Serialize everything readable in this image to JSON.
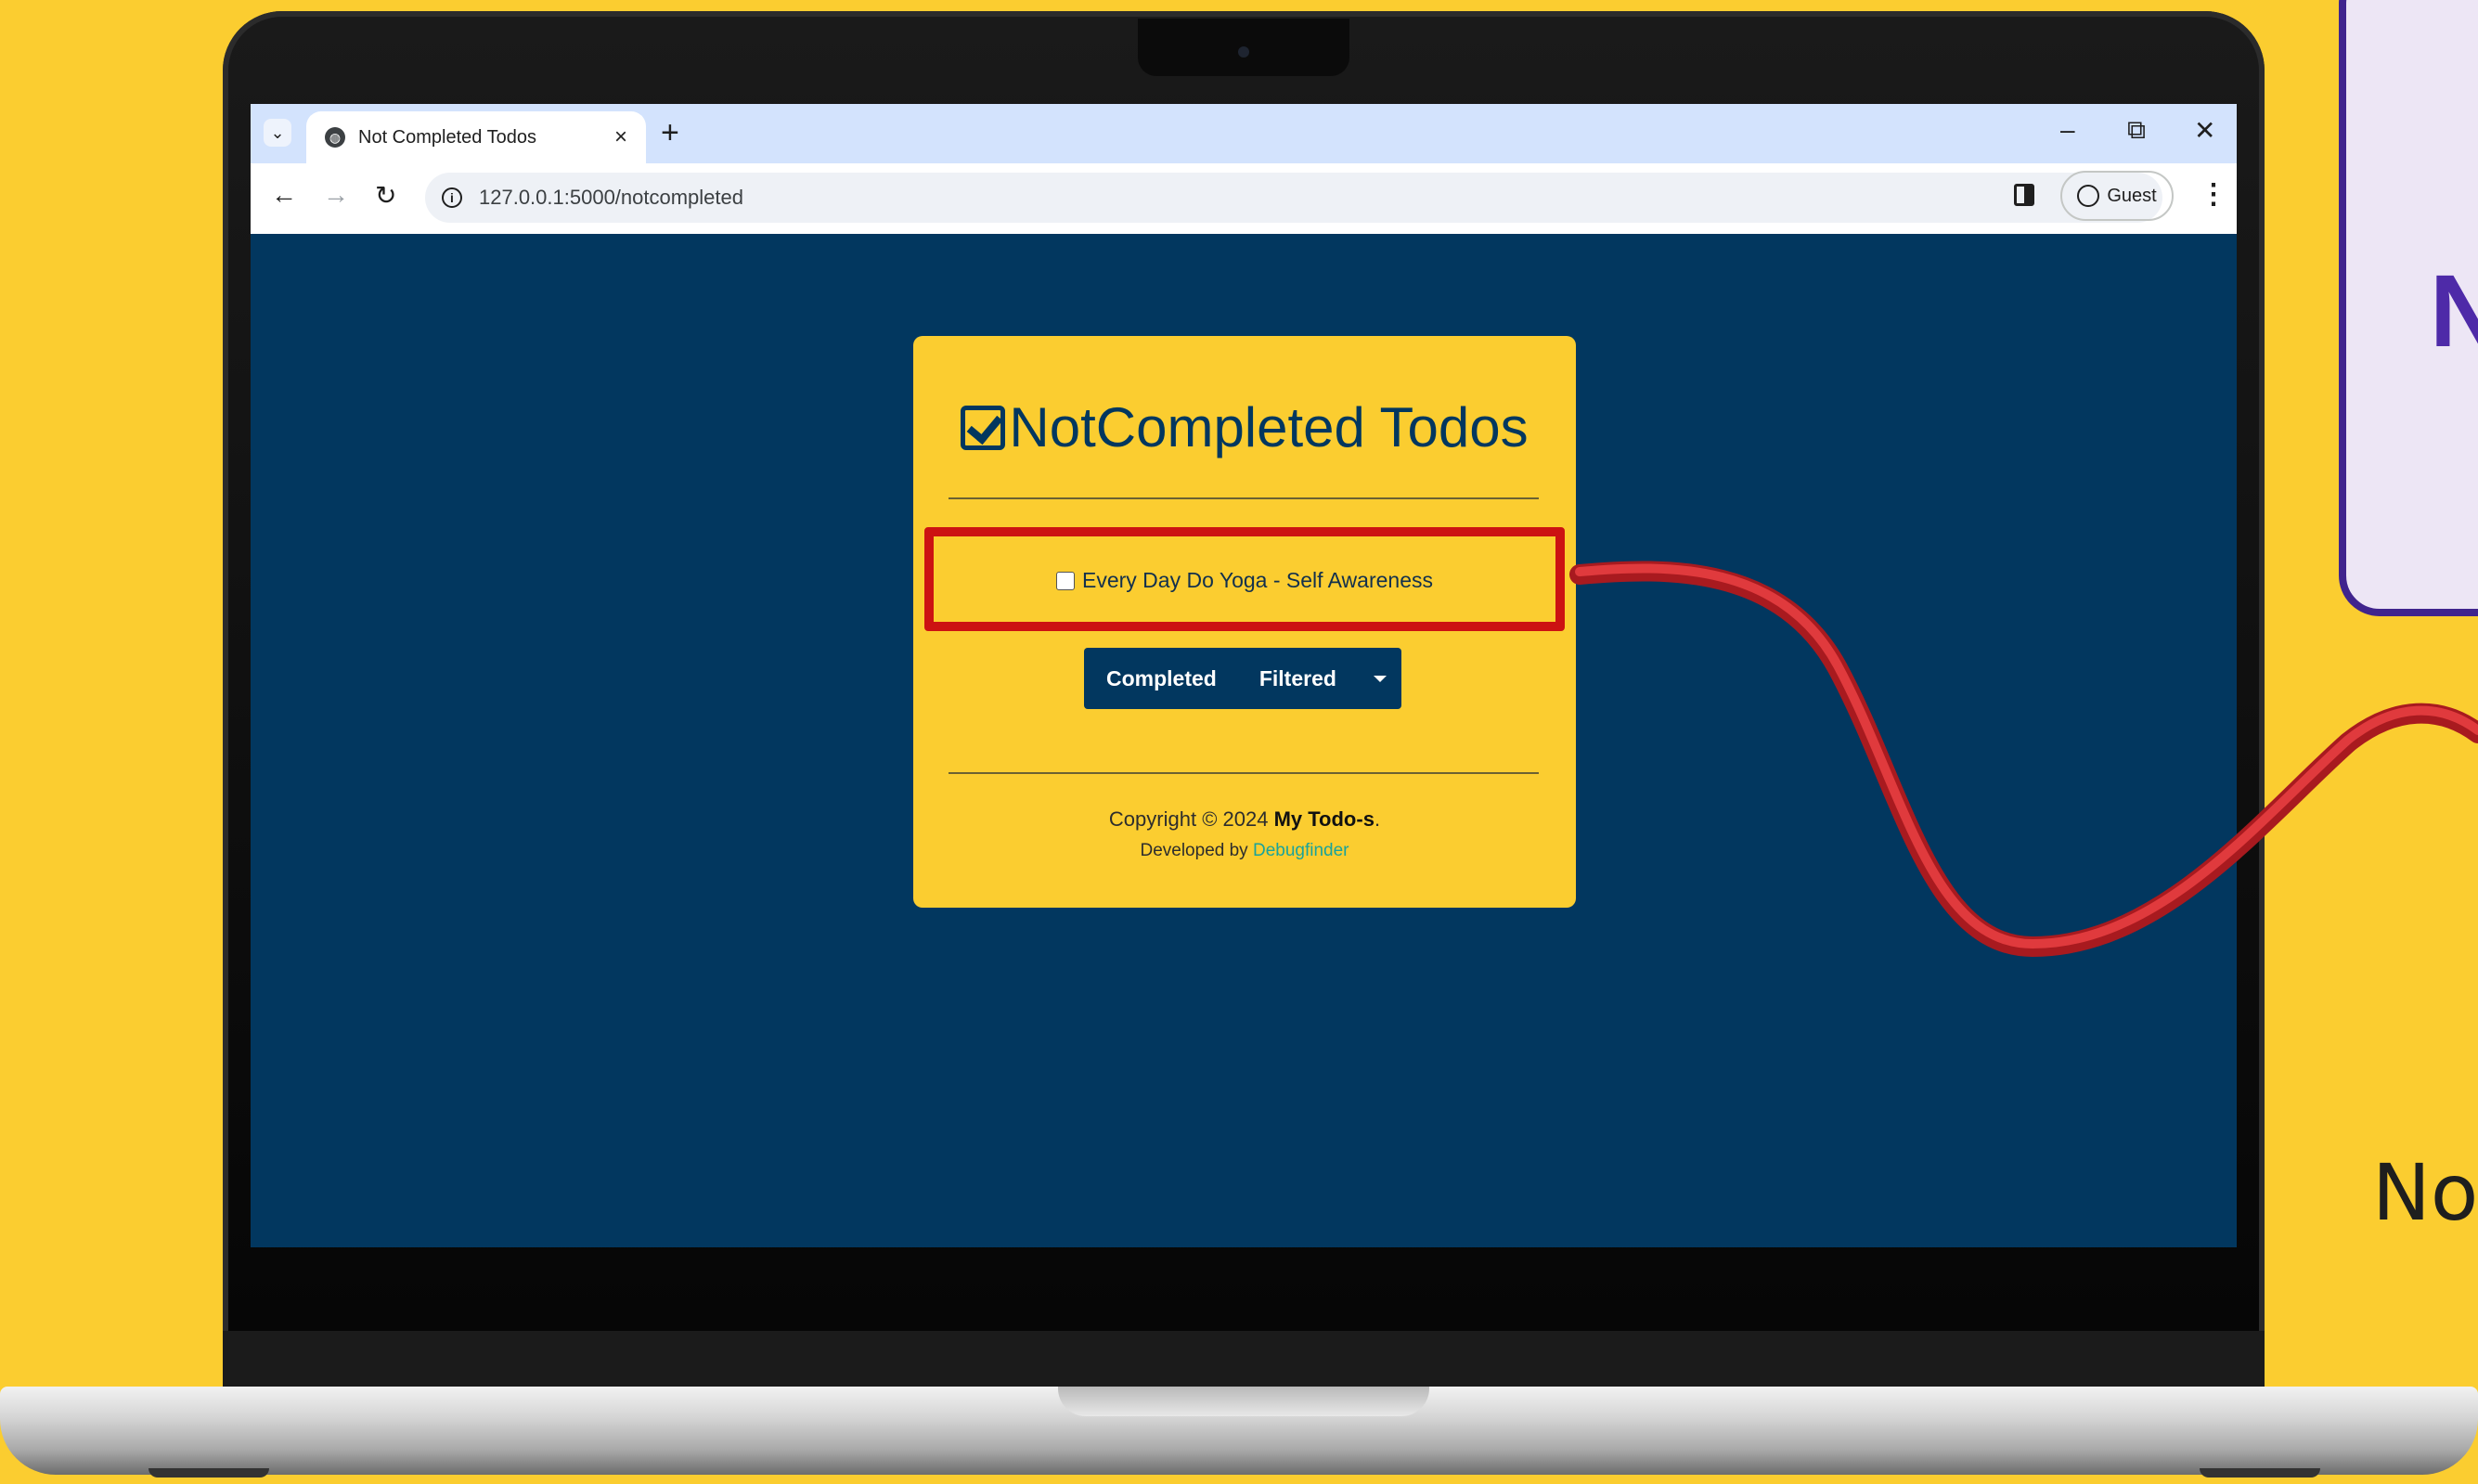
{
  "browser": {
    "tab_title": "Not Completed Todos",
    "tab_close": "×",
    "new_tab": "+",
    "address": "127.0.0.1:5000/notcompleted",
    "profile_label": "Guest",
    "window_controls": {
      "minimize": "–",
      "restore": "⧉",
      "close": "✕"
    }
  },
  "page": {
    "title": "NotCompleted Todos",
    "todos": [
      {
        "label": "Every Day Do Yoga - Self Awareness",
        "checked": false
      }
    ],
    "filter_buttons": {
      "completed": "Completed",
      "filtered": "Filtered"
    },
    "footer": {
      "copyright_prefix": "Copyright © 2024",
      "brand": "My Todo-s",
      "copyright_suffix": ".",
      "developed_by": "Developed by",
      "developer": "Debugfinder"
    }
  },
  "decor": {
    "side_letter": "N",
    "side_text": "No"
  },
  "colors": {
    "background": "#fbcd30",
    "screen": "#02375f",
    "card": "#fbcd30",
    "highlight": "#cc1212",
    "link": "#1aa39a"
  },
  "icons": [
    "tab-list-icon",
    "globe-icon",
    "back-icon",
    "forward-icon",
    "reload-icon",
    "info-icon",
    "side-panel-icon",
    "profile-icon",
    "more-icon",
    "check-square-icon",
    "caret-down-icon"
  ]
}
